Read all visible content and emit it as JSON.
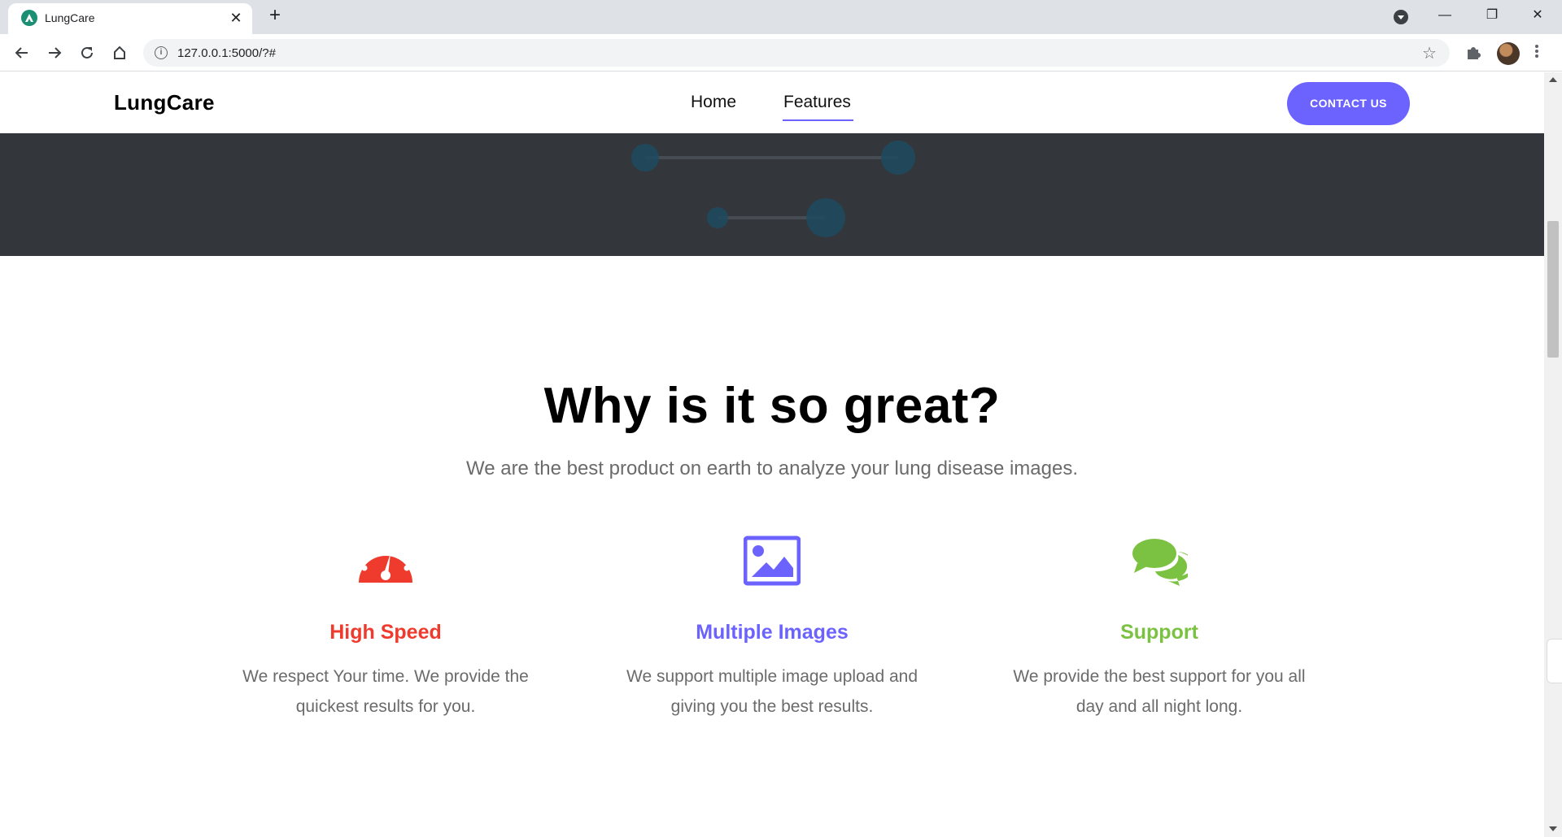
{
  "browser": {
    "tab_title": "LungCare",
    "url": "127.0.0.1:5000/?#"
  },
  "site": {
    "brand": "LungCare",
    "nav": [
      {
        "label": "Home",
        "active": false
      },
      {
        "label": "Features",
        "active": true
      }
    ],
    "contact_label": "CONTACT US",
    "accent_color": "#6c63ff"
  },
  "features_section": {
    "title": "Why is it so great?",
    "subtitle": "We are the best product on earth to analyze your lung disease images.",
    "items": [
      {
        "icon": "speedometer-icon",
        "title": "High Speed",
        "description": "We respect Your time. We provide the quickest results for you.",
        "color": "#ef3b2d"
      },
      {
        "icon": "image-icon",
        "title": "Multiple Images",
        "description": "We support multiple image upload and giving you the best results.",
        "color": "#6c63ff"
      },
      {
        "icon": "chat-bubbles-icon",
        "title": "Support",
        "description": "We provide the best support for you all day and all night long.",
        "color": "#7cc242"
      }
    ]
  }
}
